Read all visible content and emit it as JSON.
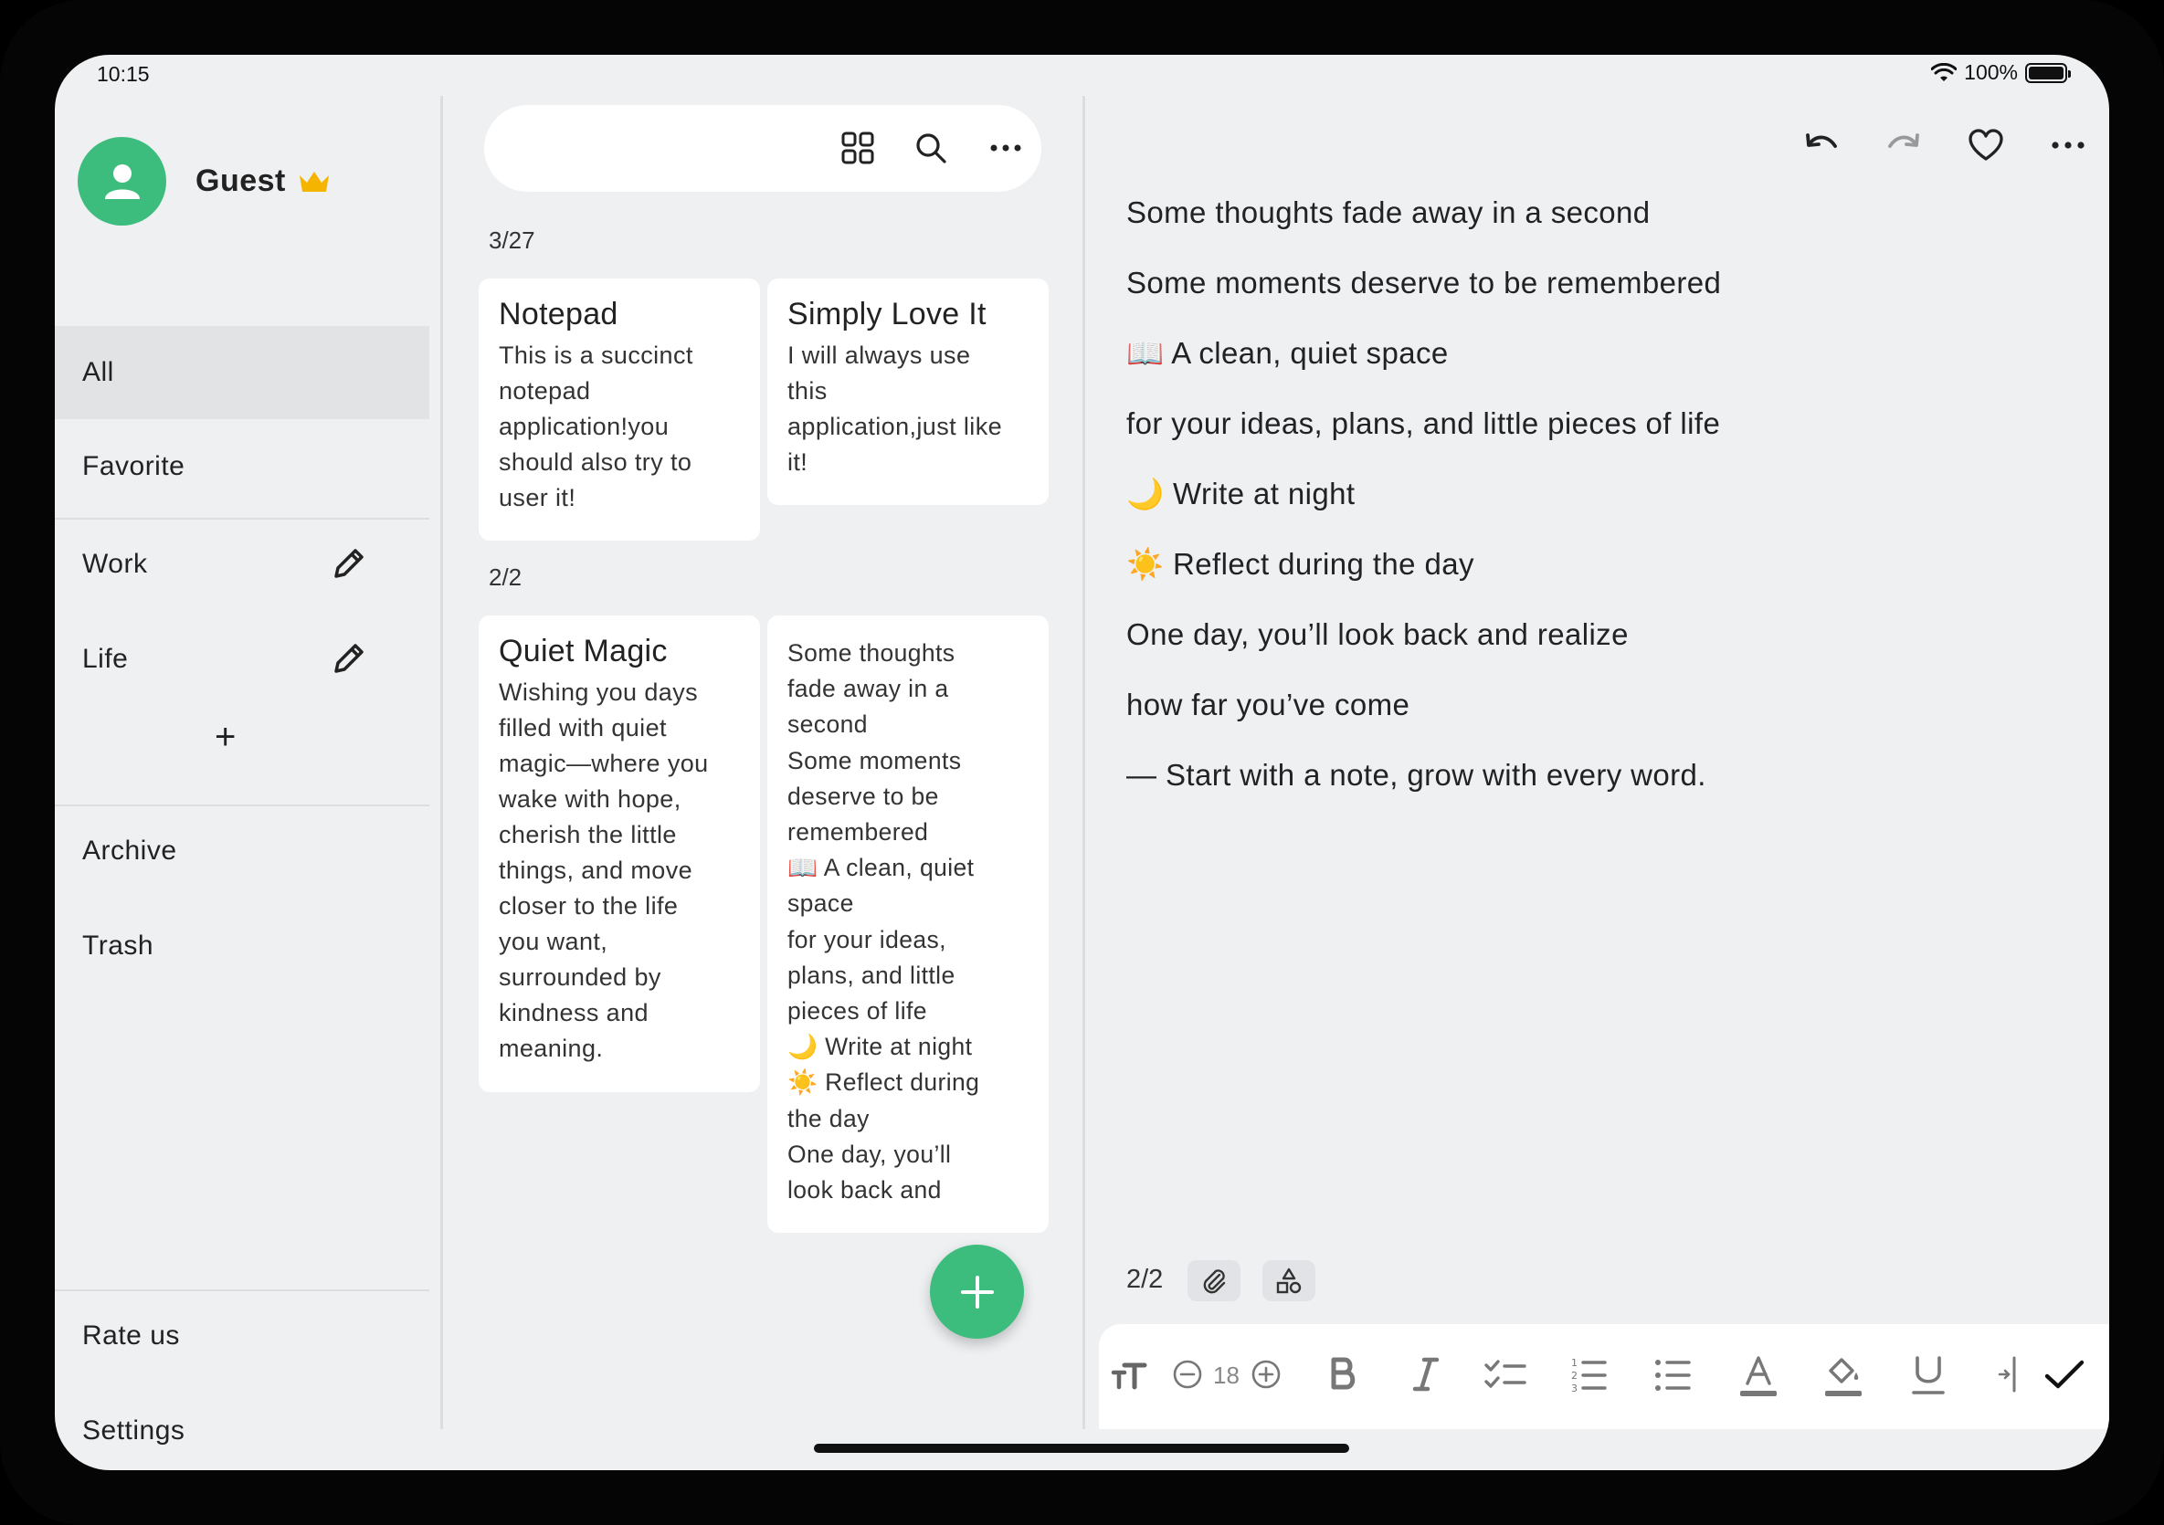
{
  "status_bar": {
    "time": "10:15",
    "battery": "100%"
  },
  "sidebar": {
    "username": "Guest",
    "items": [
      {
        "label": "All"
      },
      {
        "label": "Favorite"
      },
      {
        "label": "Work"
      },
      {
        "label": "Life"
      },
      {
        "label": "Archive"
      },
      {
        "label": "Trash"
      }
    ],
    "footer": [
      {
        "label": "Rate us"
      },
      {
        "label": "Settings"
      }
    ],
    "add_label": "+"
  },
  "list": {
    "groups": [
      {
        "date": "3/27"
      },
      {
        "date": "2/2"
      }
    ],
    "cards": [
      {
        "title": "Notepad",
        "body": "This is a succinct\nnotepad\napplication!you\nshould also try to\nuser it!"
      },
      {
        "title": "Simply Love It",
        "body": "I will always use\nthis\napplication,just like\nit!"
      },
      {
        "title": "Quiet Magic",
        "body": "Wishing you days\nfilled with quiet\nmagic—where you\nwake with hope,\ncherish the little\nthings, and move\ncloser to the life\nyou want,\nsurrounded by\nkindness and\nmeaning."
      },
      {
        "title": "",
        "body": "Some thoughts\nfade away in a\nsecond\nSome moments\ndeserve to be\nremembered\n📖  A clean, quiet\nspace\nfor your ideas,\nplans, and little\npieces of life\n🌙  Write at night\n☀️  Reflect during\nthe day\nOne day, you’ll\nlook back and"
      }
    ]
  },
  "editor": {
    "lines": [
      "Some thoughts fade away in a second",
      "Some moments deserve to be remembered",
      "📖  A clean, quiet space",
      "for your ideas, plans, and little pieces of life",
      "🌙  Write at night",
      "☀️  Reflect during the day",
      "One day, you’ll look back and realize",
      "how far you’ve come",
      "— Start with a note, grow with every word."
    ],
    "note_count": "2/2",
    "font_size": "18"
  },
  "colors": {
    "accent": "#3dbd7d",
    "crown": "#f5b400",
    "background": "#eef0f2"
  },
  "icons": {
    "toolbar": [
      "text-size-icon",
      "minus-circle-icon",
      "plus-circle-icon",
      "bold-icon",
      "italic-icon",
      "checklist-icon",
      "numbered-list-icon",
      "bullet-list-icon",
      "text-color-icon",
      "highlight-icon",
      "underline-icon",
      "indent-icon",
      "check-icon"
    ],
    "top": [
      "undo-icon",
      "redo-icon",
      "heart-icon",
      "more-icon"
    ]
  }
}
